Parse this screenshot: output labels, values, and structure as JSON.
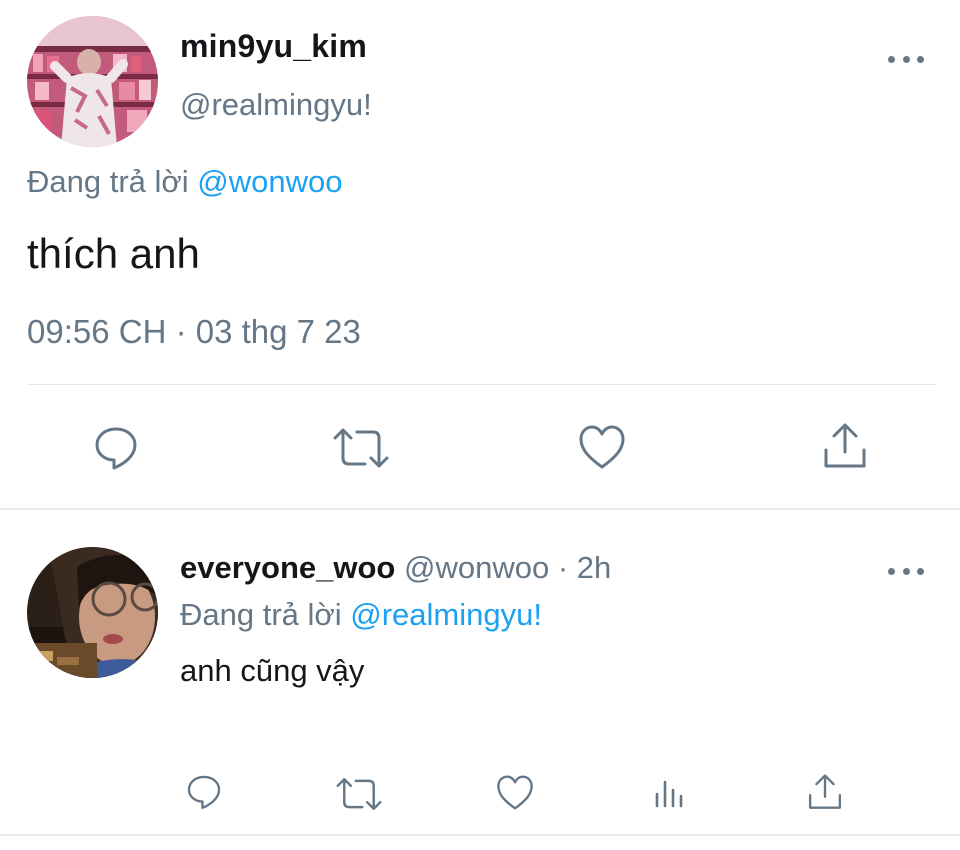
{
  "main_tweet": {
    "display_name": "min9yu_kim",
    "handle": "@realmingyu!",
    "replying_to_prefix": "Đang trả lời ",
    "replying_to_mention": "@wonwoo",
    "text": "thích anh",
    "timestamp": "09:56 CH · 03 thg 7 23",
    "actions": [
      "reply-icon",
      "retweet-icon",
      "like-icon",
      "share-icon"
    ],
    "more_icon": "more-dots-icon"
  },
  "reply_tweet": {
    "display_name": "everyone_woo",
    "handle": "@wonwoo",
    "separator": " · ",
    "time_ago": "2h",
    "replying_to_prefix": "Đang trả lời ",
    "replying_to_mention": "@realmingyu!",
    "text": "anh cũng vậy",
    "actions": [
      "reply-icon",
      "retweet-icon",
      "like-icon",
      "analytics-icon",
      "share-icon"
    ],
    "more_icon": "more-dots-icon"
  },
  "colors": {
    "text_primary": "#14171a",
    "text_secondary": "#657786",
    "mention": "#1da1f2",
    "divider": "#e1e8ed"
  }
}
